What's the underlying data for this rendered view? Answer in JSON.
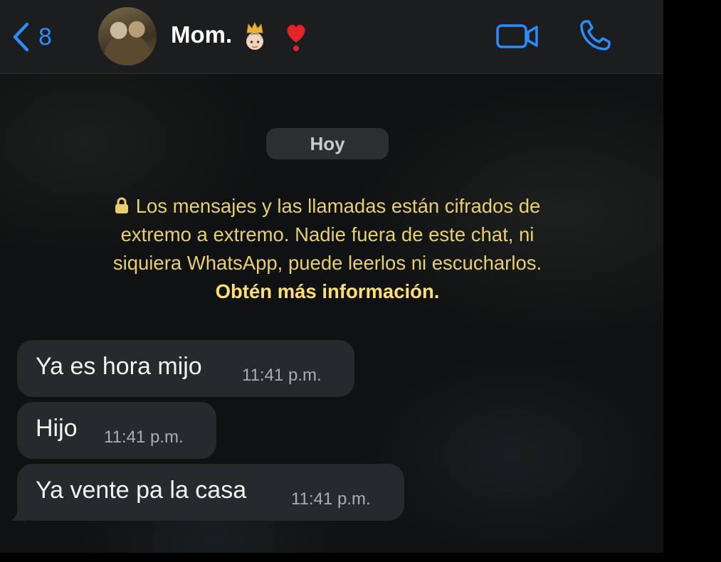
{
  "header": {
    "back_count": "8",
    "contact_name": "Mom.",
    "icons": [
      "chevron-left-icon",
      "crown-woman-emoji",
      "red-heart-emoji",
      "video-camera-icon",
      "phone-icon"
    ],
    "accent_color": "#2a8cff"
  },
  "chat": {
    "date_label": "Hoy",
    "encryption_notice": {
      "text": "Los mensajes y las llamadas están cifrados de extremo a extremo. Nadie fuera de este chat, ni siquiera WhatsApp, puede leerlos ni escucharlos.",
      "link": "Obtén más información.",
      "color": "#e7cf6e"
    },
    "messages": [
      {
        "text": "Ya es hora mijo",
        "time": "11:41 p.m."
      },
      {
        "text": "Hijo",
        "time": "11:41 p.m."
      },
      {
        "text": "Ya vente pa la casa",
        "time": "11:41 p.m."
      }
    ]
  }
}
